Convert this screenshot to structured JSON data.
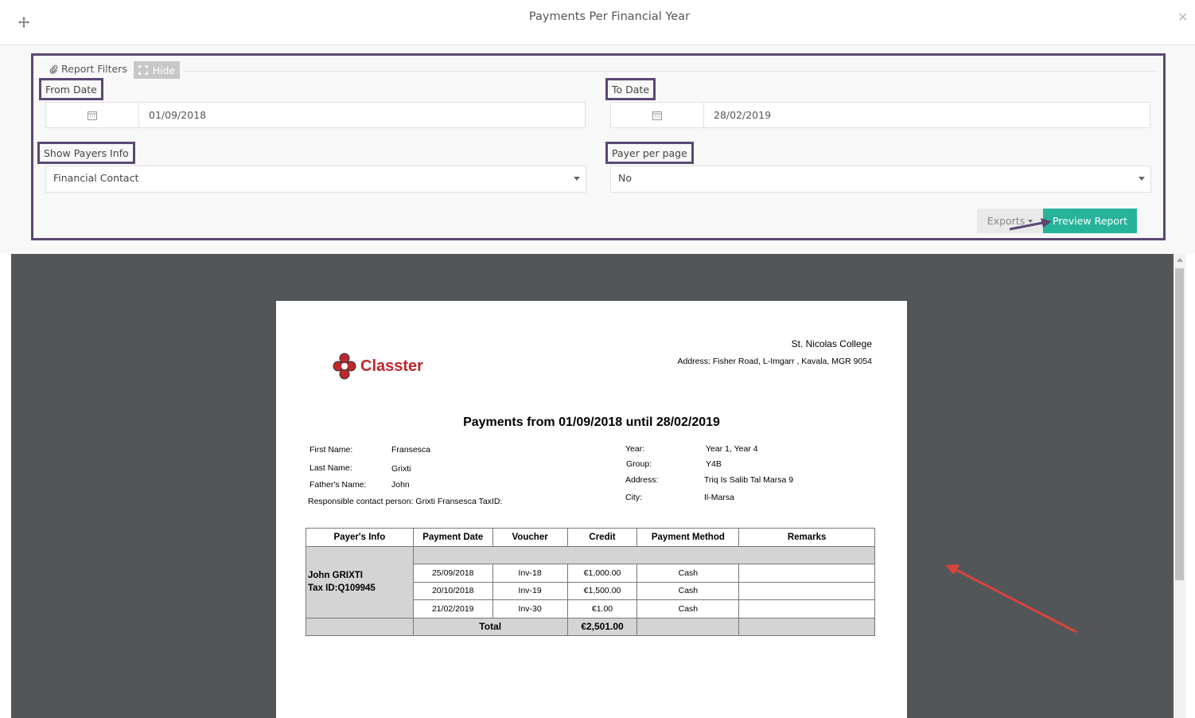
{
  "modal": {
    "title": "Payments Per Financial Year"
  },
  "filters": {
    "section_label": "Report Filters",
    "hide_label": "Hide",
    "from_date": {
      "label": "From Date",
      "value": "01/09/2018"
    },
    "to_date": {
      "label": "To Date",
      "value": "28/02/2019"
    },
    "show_payers_info": {
      "label": "Show Payers Info",
      "value": "Financial Contact"
    },
    "payer_per_page": {
      "label": "Payer per page",
      "value": "No"
    },
    "exports_label": "Exports",
    "preview_label": "Preview Report"
  },
  "report": {
    "logo_text": "Classter",
    "school_name": "St. Nicolas College",
    "school_address": "Address: Fisher Road, L-Imgarr , Kavala, MGR 9054",
    "title": "Payments from 01/09/2018 until 28/02/2019",
    "student": {
      "first_name_label": "First Name:",
      "first_name": "Fransesca",
      "last_name_label": "Last Name:",
      "last_name": "Grixti",
      "father_label": "Father's Name:",
      "father": "John",
      "responsible": "Responsible contact person: Grixti Fransesca TaxID:",
      "year_label": "Year:",
      "year": "Year 1, Year 4",
      "group_label": "Group:",
      "group": "Y4B",
      "address_label": "Address:",
      "address": "Triq Is Salib Tal Marsa 9",
      "city_label": "City:",
      "city": "Il-Marsa"
    },
    "table": {
      "headers": [
        "Payer's Info",
        "Payment Date",
        "Voucher",
        "Credit",
        "Payment Method",
        "Remarks"
      ],
      "payer_name": "John GRIXTI",
      "payer_tax": "Tax ID:Q109945",
      "rows": [
        {
          "date": "25/09/2018",
          "voucher": "Inv-18",
          "credit": "€1,000.00",
          "method": "Cash",
          "remarks": ""
        },
        {
          "date": "20/10/2018",
          "voucher": "Inv-19",
          "credit": "€1,500.00",
          "method": "Cash",
          "remarks": ""
        },
        {
          "date": "21/02/2019",
          "voucher": "Inv-30",
          "credit": "€1.00",
          "method": "Cash",
          "remarks": ""
        }
      ],
      "total_label": "Total",
      "total_value": "€2,501.00"
    }
  },
  "colors": {
    "highlight_border": "#5b4874",
    "preview_button": "#26b39a",
    "annotation_arrow": "#d9443a",
    "logo_red": "#c0272d"
  },
  "icons": [
    "move-icon",
    "close-icon",
    "paperclip-icon",
    "expand-icon",
    "calendar-icon",
    "chevron-down-icon"
  ]
}
